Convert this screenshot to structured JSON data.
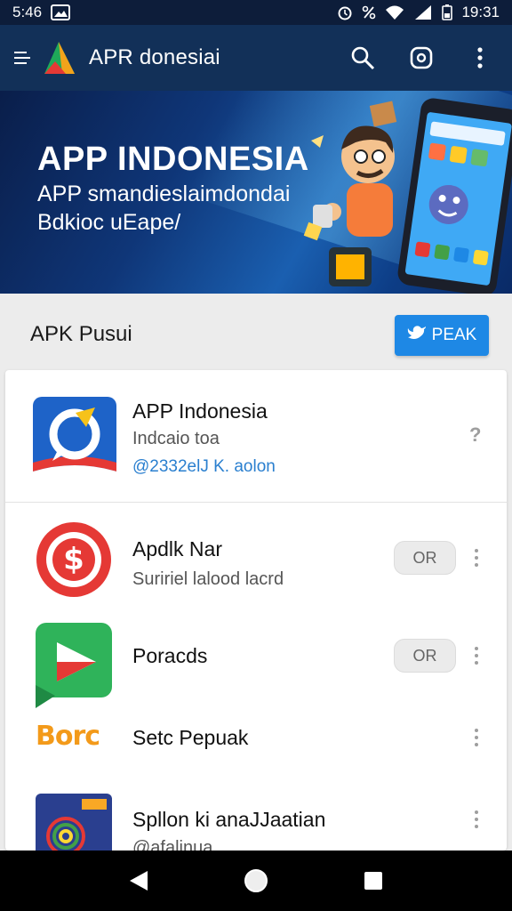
{
  "status_bar": {
    "time_left": "5:46",
    "time_right": "19:31",
    "icons": [
      "gallery-icon",
      "alarm-icon",
      "percent-icon",
      "wifi-icon",
      "signal-icon",
      "battery-icon"
    ]
  },
  "app_bar": {
    "title": "APR donesiai",
    "actions": [
      "search-icon",
      "settings-icon",
      "overflow-menu-icon"
    ]
  },
  "banner": {
    "headline": "APP INDONESIA",
    "subtitle_line1": "APP smandieslaimdondai",
    "subtitle_line2": "Bdkioc uEape/"
  },
  "section": {
    "title": "APK Pusui",
    "button_label": "PEAK"
  },
  "apps": [
    {
      "name": "APP Indonesia",
      "description": "Indcaio toa",
      "meta": "@2332elJ K. aolon",
      "trailing": "?",
      "icon": "chat-bubble-icon"
    },
    {
      "name": "Apdlk Nar",
      "description": "Suririel lalood lacrd",
      "toggle": "OR",
      "icon": "dollar-badge-icon"
    },
    {
      "name": "Poracds",
      "toggle": "OR",
      "icon": "play-triangle-icon"
    },
    {
      "name": "Setc Pepuak",
      "logo_text": "Borc",
      "icon": "borc-logo-icon"
    },
    {
      "name": "Spllon ki anaJJaatian",
      "description": "@afalinua",
      "icon": "spiral-card-icon"
    }
  ],
  "colors": {
    "app_bar": "#123058",
    "accent": "#1e88e5",
    "link": "#2a7fcf"
  }
}
